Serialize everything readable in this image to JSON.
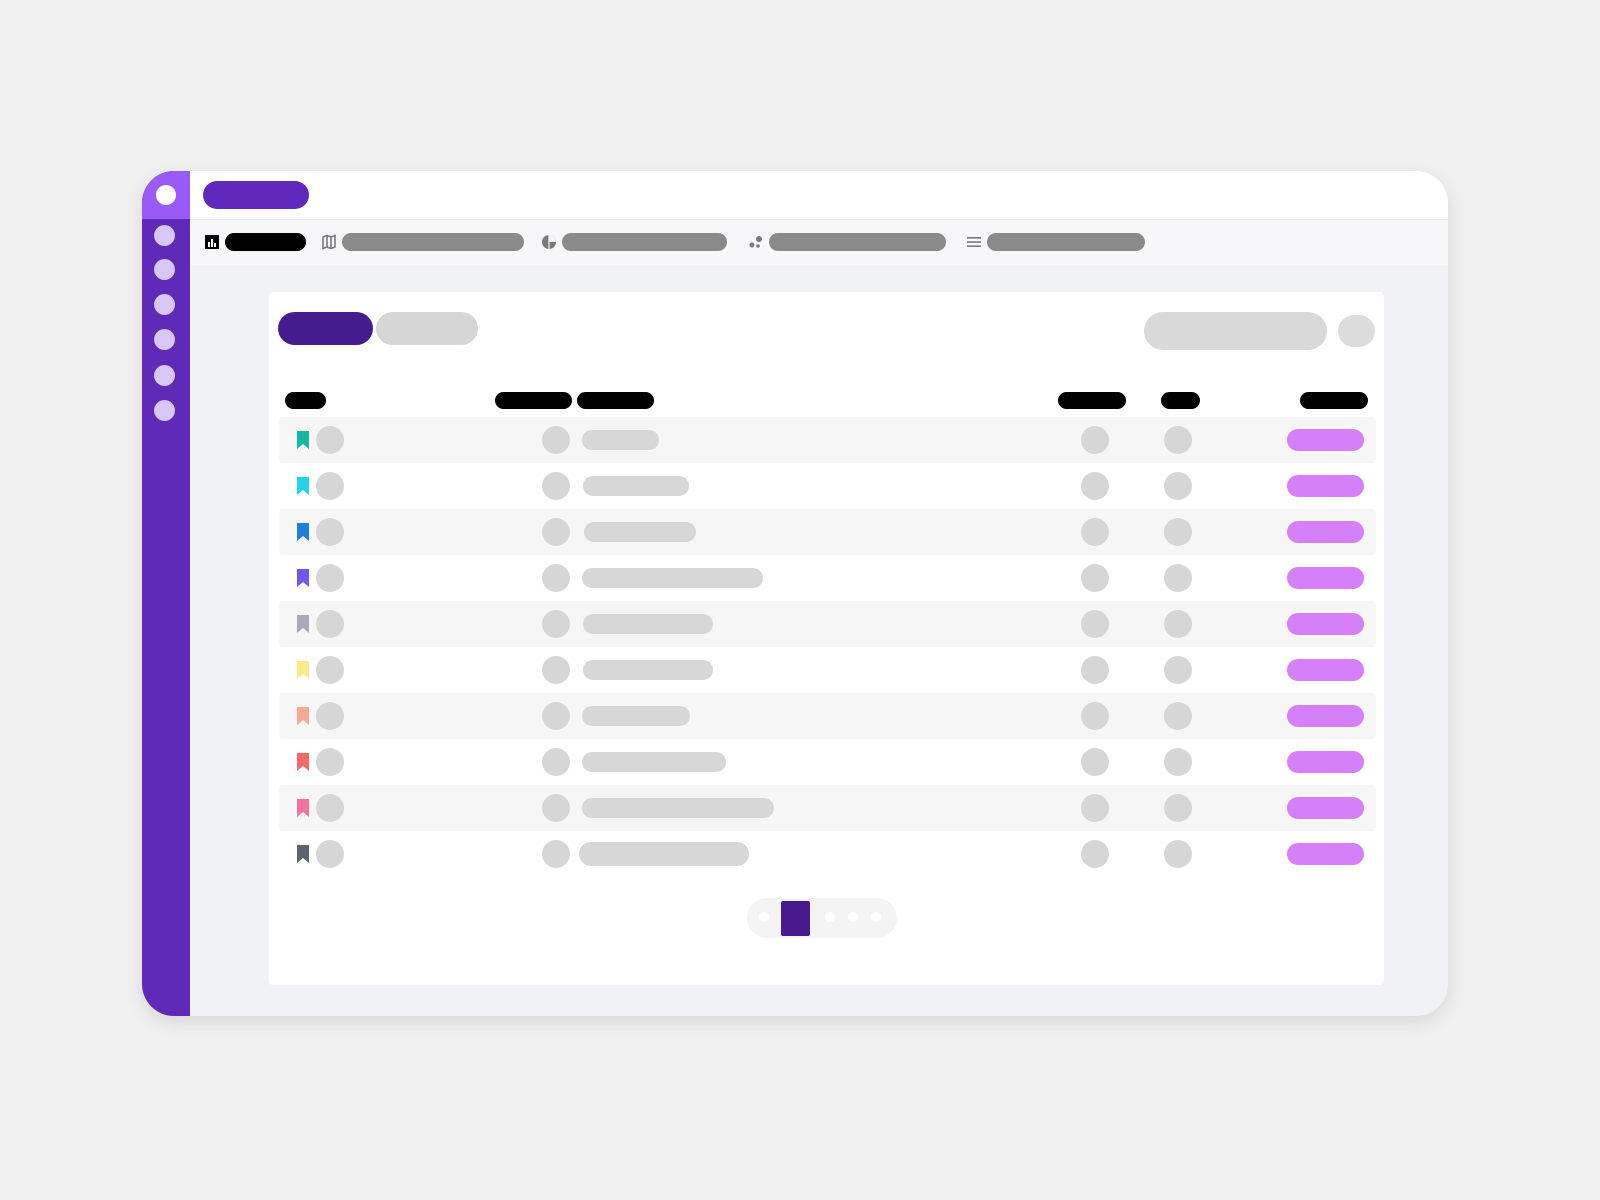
{
  "app": {
    "title": "",
    "accent_color": "#6129bb",
    "sidebar_color": "#5f2ab8"
  },
  "sidebar": {
    "items": [
      {
        "icon": "circle-icon"
      },
      {
        "icon": "circle-icon"
      },
      {
        "icon": "circle-icon"
      },
      {
        "icon": "circle-icon"
      },
      {
        "icon": "circle-icon"
      },
      {
        "icon": "circle-icon"
      }
    ]
  },
  "tabs": [
    {
      "icon": "bar-chart-icon",
      "label": "",
      "active": true
    },
    {
      "icon": "map-icon",
      "label": "",
      "active": false
    },
    {
      "icon": "pie-chart-icon",
      "label": "",
      "active": false
    },
    {
      "icon": "scatter-icon",
      "label": "",
      "active": false
    },
    {
      "icon": "list-icon",
      "label": "",
      "active": false
    }
  ],
  "toolbar": {
    "view_active": "",
    "view_inactive": "",
    "search_placeholder": ""
  },
  "table": {
    "headers": [
      "",
      "",
      "",
      "",
      "",
      ""
    ],
    "rows": [
      {
        "bookmark_color": "#14b8a6",
        "status": ""
      },
      {
        "bookmark_color": "#22d3ee",
        "status": ""
      },
      {
        "bookmark_color": "#1d7fe0",
        "status": ""
      },
      {
        "bookmark_color": "#7356f0",
        "status": ""
      },
      {
        "bookmark_color": "#a8acb6",
        "status": ""
      },
      {
        "bookmark_color": "#fbe98a",
        "status": ""
      },
      {
        "bookmark_color": "#f5a894",
        "status": ""
      },
      {
        "bookmark_color": "#f46a6a",
        "status": ""
      },
      {
        "bookmark_color": "#f472a0",
        "status": ""
      },
      {
        "bookmark_color": "#5c6370",
        "status": ""
      }
    ]
  },
  "pagination": {
    "current_page": 1,
    "status_color": "#d57ff9"
  }
}
